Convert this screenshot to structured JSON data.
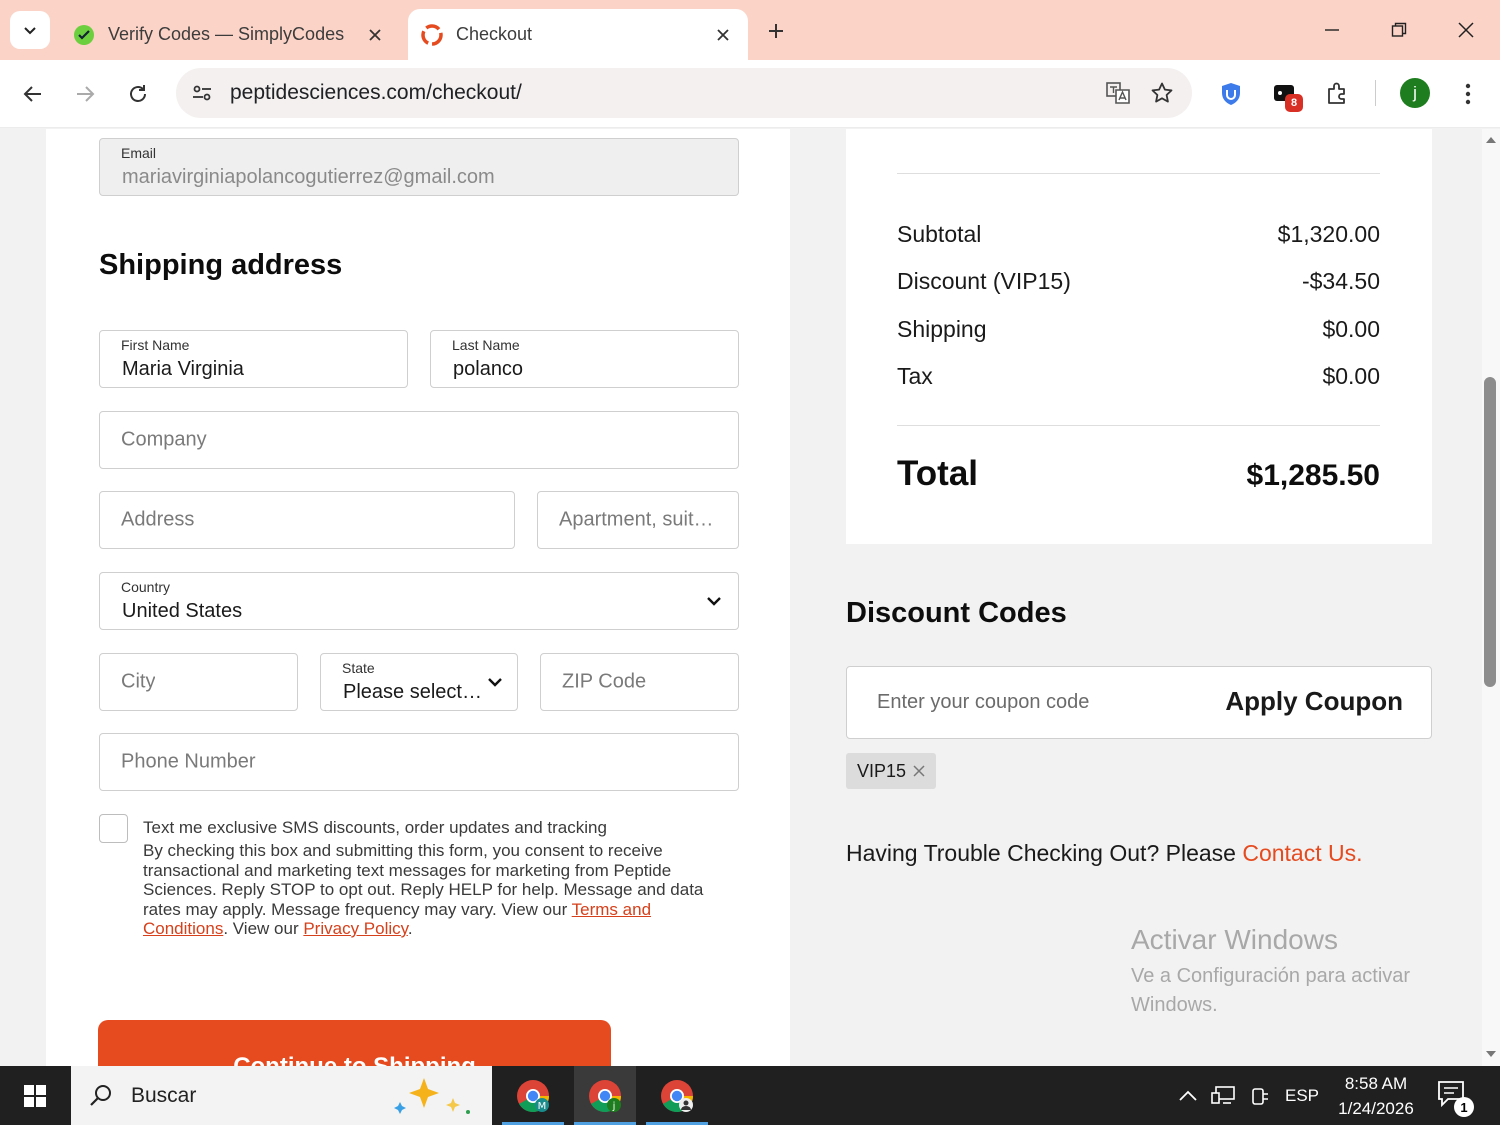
{
  "browser": {
    "tabs": [
      {
        "title": "Verify Codes — SimplyCodes",
        "active": false
      },
      {
        "title": "Checkout",
        "active": true
      }
    ],
    "url": "peptidesciences.com/checkout/",
    "extensions_badge": "8",
    "profile_initial": "j"
  },
  "form": {
    "email": {
      "label": "Email",
      "value": "mariavirginiapolancogutierrez@gmail.com"
    },
    "shipping_title": "Shipping address",
    "first_name": {
      "label": "First Name",
      "value": "Maria Virginia"
    },
    "last_name": {
      "label": "Last Name",
      "value": "polanco"
    },
    "company_placeholder": "Company",
    "address_placeholder": "Address",
    "apartment_placeholder": "Apartment, suite, etc.",
    "country": {
      "label": "Country",
      "value": "United States"
    },
    "city_placeholder": "City",
    "state": {
      "label": "State",
      "value": "Please select a state"
    },
    "zip_placeholder": "ZIP Code",
    "phone_placeholder": "Phone Number",
    "sms_title": "Text me exclusive SMS discounts, order updates and tracking",
    "sms_body": "By checking this box and submitting this form, you consent to receive transactional and marketing text messages for marketing from Peptide Sciences. Reply STOP to opt out. Reply HELP for help. Message and data rates may apply. Message frequency may vary. View our ",
    "terms_link": "Terms and Conditions",
    "sms_mid": ". View our ",
    "privacy_link": "Privacy Policy",
    "sms_end": ".",
    "cta_label": "Continue to Shipping"
  },
  "summary": {
    "rows": [
      {
        "label": "Subtotal",
        "value": "$1,320.00"
      },
      {
        "label": "Discount (VIP15)",
        "value": "-$34.50"
      },
      {
        "label": "Shipping",
        "value": "$0.00"
      },
      {
        "label": "Tax",
        "value": "$0.00"
      }
    ],
    "total_label": "Total",
    "total_value": "$1,285.50"
  },
  "discount": {
    "title": "Discount Codes",
    "placeholder": "Enter your coupon code",
    "apply_label": "Apply Coupon",
    "applied_code": "VIP15"
  },
  "help": {
    "text": "Having Trouble Checking Out? Please ",
    "link": "Contact Us",
    "end": "."
  },
  "watermark": {
    "line1": "Activar Windows",
    "line2": "Ve a Configuración para activar Windows."
  },
  "taskbar": {
    "search_label": "Buscar",
    "language": "ESP",
    "time": "8:58 AM",
    "date": "1/24/2026",
    "notifications": "1"
  },
  "colors": {
    "accent": "#e64a1f",
    "tabstrip": "#fbd3c7"
  }
}
